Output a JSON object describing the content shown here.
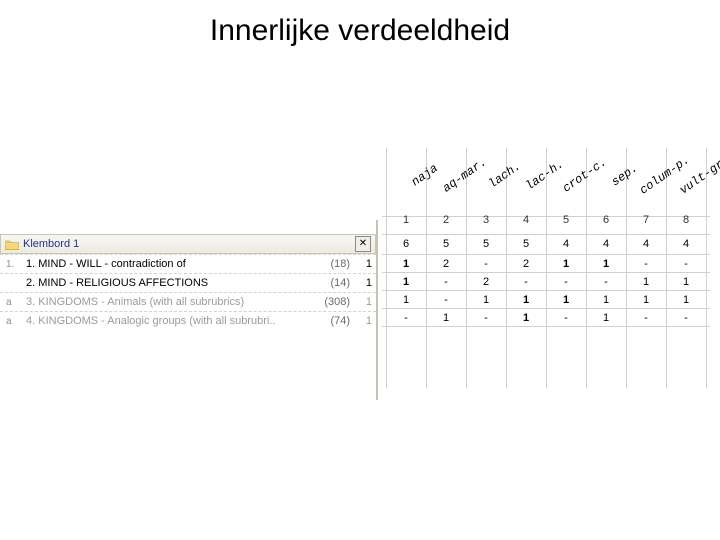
{
  "title": "Innerlijke verdeeldheid",
  "clipboard": {
    "header": "Klembord 1",
    "close": "✕",
    "rows": [
      {
        "prefix": "1.",
        "label": "1. MIND - WILL - contradiction of",
        "count": "(18)",
        "first": "1",
        "faded": false
      },
      {
        "prefix": "",
        "label": "2. MIND - RELIGIOUS AFFECTIONS",
        "count": "(14)",
        "first": "1",
        "faded": false
      },
      {
        "prefix": "a",
        "label": "3. KINGDOMS - Animals (with all subrubrics)",
        "count": "(308)",
        "first": "1",
        "faded": true
      },
      {
        "prefix": "a",
        "label": "4. KINGDOMS - Analogic groups (with all subrubri..",
        "count": "(74)",
        "first": "1",
        "faded": true
      }
    ]
  },
  "columns": [
    {
      "name": "naja",
      "idx": "1"
    },
    {
      "name": "aq-mar.",
      "idx": "2"
    },
    {
      "name": "lach.",
      "idx": "3"
    },
    {
      "name": "lac-h.",
      "idx": "4"
    },
    {
      "name": "crot-c.",
      "idx": "5"
    },
    {
      "name": "sep.",
      "idx": "6"
    },
    {
      "name": "colum-p.",
      "idx": "7"
    },
    {
      "name": "vult-gr.",
      "idx": "8"
    }
  ],
  "summary_row": [
    "6",
    "5",
    "5",
    "5",
    "4",
    "4",
    "4",
    "4"
  ],
  "data_rows": [
    [
      "1",
      "2",
      "-",
      "2",
      "1",
      "1",
      "-",
      "-"
    ],
    [
      "1",
      "-",
      "2",
      "-",
      "-",
      "-",
      "1",
      "1"
    ],
    [
      "1",
      "-",
      "1",
      "1",
      "1",
      "1",
      "1",
      "1"
    ],
    [
      "-",
      "1",
      "-",
      "1",
      "-",
      "1",
      "-",
      "-"
    ]
  ],
  "bold_map": [
    [
      true,
      false,
      false,
      false,
      true,
      true,
      false,
      false
    ],
    [
      true,
      false,
      false,
      false,
      false,
      false,
      false,
      false
    ],
    [
      false,
      false,
      false,
      true,
      true,
      false,
      false,
      false
    ],
    [
      false,
      false,
      false,
      true,
      false,
      false,
      false,
      false
    ]
  ],
  "chart_data": {
    "type": "table",
    "title": "Innerlijke verdeeldheid",
    "columns": [
      "naja",
      "aq-mar.",
      "lach.",
      "lac-h.",
      "crot-c.",
      "sep.",
      "colum-p.",
      "vult-gr."
    ],
    "column_indices": [
      1,
      2,
      3,
      4,
      5,
      6,
      7,
      8
    ],
    "totals": [
      6,
      5,
      5,
      5,
      4,
      4,
      4,
      4
    ],
    "rubrics": [
      {
        "label": "MIND - WILL - contradiction of",
        "count": 18,
        "values": [
          1,
          2,
          null,
          2,
          1,
          1,
          null,
          null
        ]
      },
      {
        "label": "MIND - RELIGIOUS AFFECTIONS",
        "count": 14,
        "values": [
          1,
          null,
          2,
          null,
          null,
          null,
          1,
          1
        ]
      },
      {
        "label": "KINGDOMS - Animals (with all subrubrics)",
        "count": 308,
        "values": [
          1,
          null,
          1,
          1,
          1,
          1,
          1,
          1
        ]
      },
      {
        "label": "KINGDOMS - Analogic groups (with all subrubrics)",
        "count": 74,
        "values": [
          null,
          1,
          null,
          1,
          null,
          1,
          null,
          null
        ]
      }
    ]
  }
}
